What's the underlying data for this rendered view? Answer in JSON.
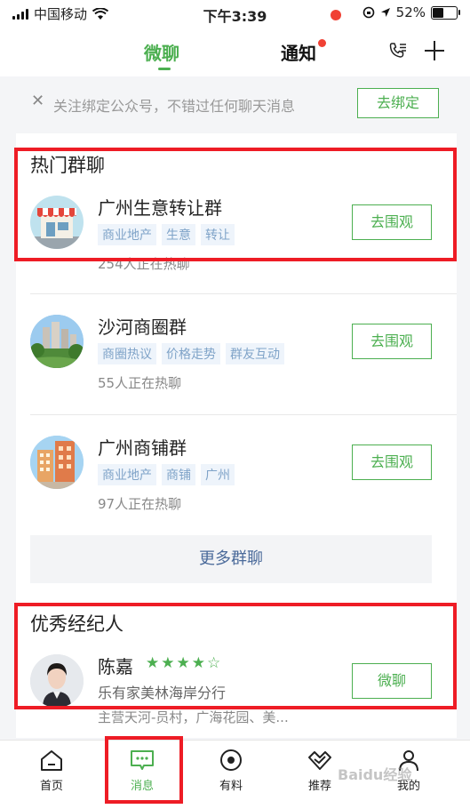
{
  "status_bar": {
    "carrier": "中国移动",
    "time": "下午3:39",
    "battery": "52%",
    "battery_level": 0.52
  },
  "top_nav": {
    "tabs": [
      {
        "label": "微聊",
        "active": true
      },
      {
        "label": "通知",
        "has_badge": true
      }
    ],
    "icons": [
      "phone-list-icon",
      "plus-icon"
    ]
  },
  "bind_banner": {
    "text": "关注绑定公众号，不错过任何聊天消息",
    "button": "去绑定"
  },
  "hot_groups": {
    "title": "热门群聊",
    "items": [
      {
        "name": "广州生意转让群",
        "tags": [
          "商业地产",
          "生意",
          "转让"
        ],
        "count": "254人正在热聊",
        "button": "去围观"
      },
      {
        "name": "沙河商圈群",
        "tags": [
          "商圈热议",
          "价格走势",
          "群友互动"
        ],
        "count": "55人正在热聊",
        "button": "去围观"
      },
      {
        "name": "广州商铺群",
        "tags": [
          "商业地产",
          "商铺",
          "广州"
        ],
        "count": "97人正在热聊",
        "button": "去围观"
      }
    ],
    "more_button": "更多群聊"
  },
  "agents": {
    "title": "优秀经纪人",
    "items": [
      {
        "name": "陈嘉",
        "rating": 4,
        "rating_max": 5,
        "company": "乐有家美林海岸分行",
        "area": "主营天河-员村，广海花园、美...",
        "button": "微聊"
      }
    ]
  },
  "bottom_nav": {
    "items": [
      {
        "label": "首页",
        "icon": "home-icon"
      },
      {
        "label": "消息",
        "icon": "message-icon",
        "active": true
      },
      {
        "label": "有料",
        "icon": "target-icon"
      },
      {
        "label": "推荐",
        "icon": "heart-check-icon",
        "has_badge": true
      },
      {
        "label": "我的",
        "icon": "user-icon"
      }
    ]
  },
  "watermark": "Baidu经验",
  "colors": {
    "accent": "#4caf50",
    "highlight": "#ee1c25",
    "badge": "#f04134",
    "tag_text": "#7fa3c8"
  }
}
